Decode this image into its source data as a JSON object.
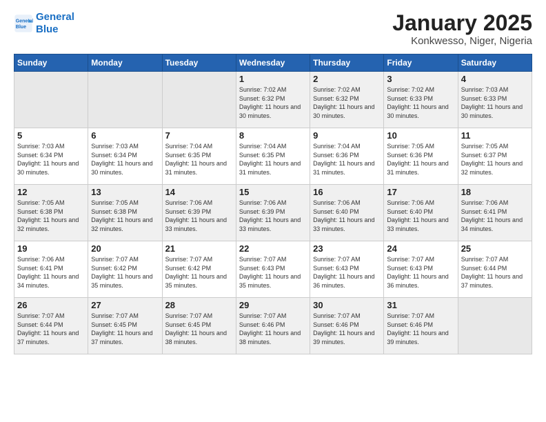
{
  "header": {
    "logo_line1": "General",
    "logo_line2": "Blue",
    "month": "January 2025",
    "location": "Konkwesso, Niger, Nigeria"
  },
  "weekdays": [
    "Sunday",
    "Monday",
    "Tuesday",
    "Wednesday",
    "Thursday",
    "Friday",
    "Saturday"
  ],
  "weeks": [
    [
      {
        "day": "",
        "empty": true
      },
      {
        "day": "",
        "empty": true
      },
      {
        "day": "",
        "empty": true
      },
      {
        "day": "1",
        "sunrise": "7:02 AM",
        "sunset": "6:32 PM",
        "daylight": "11 hours and 30 minutes."
      },
      {
        "day": "2",
        "sunrise": "7:02 AM",
        "sunset": "6:32 PM",
        "daylight": "11 hours and 30 minutes."
      },
      {
        "day": "3",
        "sunrise": "7:02 AM",
        "sunset": "6:33 PM",
        "daylight": "11 hours and 30 minutes."
      },
      {
        "day": "4",
        "sunrise": "7:03 AM",
        "sunset": "6:33 PM",
        "daylight": "11 hours and 30 minutes."
      }
    ],
    [
      {
        "day": "5",
        "sunrise": "7:03 AM",
        "sunset": "6:34 PM",
        "daylight": "11 hours and 30 minutes."
      },
      {
        "day": "6",
        "sunrise": "7:03 AM",
        "sunset": "6:34 PM",
        "daylight": "11 hours and 30 minutes."
      },
      {
        "day": "7",
        "sunrise": "7:04 AM",
        "sunset": "6:35 PM",
        "daylight": "11 hours and 31 minutes."
      },
      {
        "day": "8",
        "sunrise": "7:04 AM",
        "sunset": "6:35 PM",
        "daylight": "11 hours and 31 minutes."
      },
      {
        "day": "9",
        "sunrise": "7:04 AM",
        "sunset": "6:36 PM",
        "daylight": "11 hours and 31 minutes."
      },
      {
        "day": "10",
        "sunrise": "7:05 AM",
        "sunset": "6:36 PM",
        "daylight": "11 hours and 31 minutes."
      },
      {
        "day": "11",
        "sunrise": "7:05 AM",
        "sunset": "6:37 PM",
        "daylight": "11 hours and 32 minutes."
      }
    ],
    [
      {
        "day": "12",
        "sunrise": "7:05 AM",
        "sunset": "6:38 PM",
        "daylight": "11 hours and 32 minutes."
      },
      {
        "day": "13",
        "sunrise": "7:05 AM",
        "sunset": "6:38 PM",
        "daylight": "11 hours and 32 minutes."
      },
      {
        "day": "14",
        "sunrise": "7:06 AM",
        "sunset": "6:39 PM",
        "daylight": "11 hours and 33 minutes."
      },
      {
        "day": "15",
        "sunrise": "7:06 AM",
        "sunset": "6:39 PM",
        "daylight": "11 hours and 33 minutes."
      },
      {
        "day": "16",
        "sunrise": "7:06 AM",
        "sunset": "6:40 PM",
        "daylight": "11 hours and 33 minutes."
      },
      {
        "day": "17",
        "sunrise": "7:06 AM",
        "sunset": "6:40 PM",
        "daylight": "11 hours and 33 minutes."
      },
      {
        "day": "18",
        "sunrise": "7:06 AM",
        "sunset": "6:41 PM",
        "daylight": "11 hours and 34 minutes."
      }
    ],
    [
      {
        "day": "19",
        "sunrise": "7:06 AM",
        "sunset": "6:41 PM",
        "daylight": "11 hours and 34 minutes."
      },
      {
        "day": "20",
        "sunrise": "7:07 AM",
        "sunset": "6:42 PM",
        "daylight": "11 hours and 35 minutes."
      },
      {
        "day": "21",
        "sunrise": "7:07 AM",
        "sunset": "6:42 PM",
        "daylight": "11 hours and 35 minutes."
      },
      {
        "day": "22",
        "sunrise": "7:07 AM",
        "sunset": "6:43 PM",
        "daylight": "11 hours and 35 minutes."
      },
      {
        "day": "23",
        "sunrise": "7:07 AM",
        "sunset": "6:43 PM",
        "daylight": "11 hours and 36 minutes."
      },
      {
        "day": "24",
        "sunrise": "7:07 AM",
        "sunset": "6:43 PM",
        "daylight": "11 hours and 36 minutes."
      },
      {
        "day": "25",
        "sunrise": "7:07 AM",
        "sunset": "6:44 PM",
        "daylight": "11 hours and 37 minutes."
      }
    ],
    [
      {
        "day": "26",
        "sunrise": "7:07 AM",
        "sunset": "6:44 PM",
        "daylight": "11 hours and 37 minutes."
      },
      {
        "day": "27",
        "sunrise": "7:07 AM",
        "sunset": "6:45 PM",
        "daylight": "11 hours and 37 minutes."
      },
      {
        "day": "28",
        "sunrise": "7:07 AM",
        "sunset": "6:45 PM",
        "daylight": "11 hours and 38 minutes."
      },
      {
        "day": "29",
        "sunrise": "7:07 AM",
        "sunset": "6:46 PM",
        "daylight": "11 hours and 38 minutes."
      },
      {
        "day": "30",
        "sunrise": "7:07 AM",
        "sunset": "6:46 PM",
        "daylight": "11 hours and 39 minutes."
      },
      {
        "day": "31",
        "sunrise": "7:07 AM",
        "sunset": "6:46 PM",
        "daylight": "11 hours and 39 minutes."
      },
      {
        "day": "",
        "empty": true
      }
    ]
  ]
}
